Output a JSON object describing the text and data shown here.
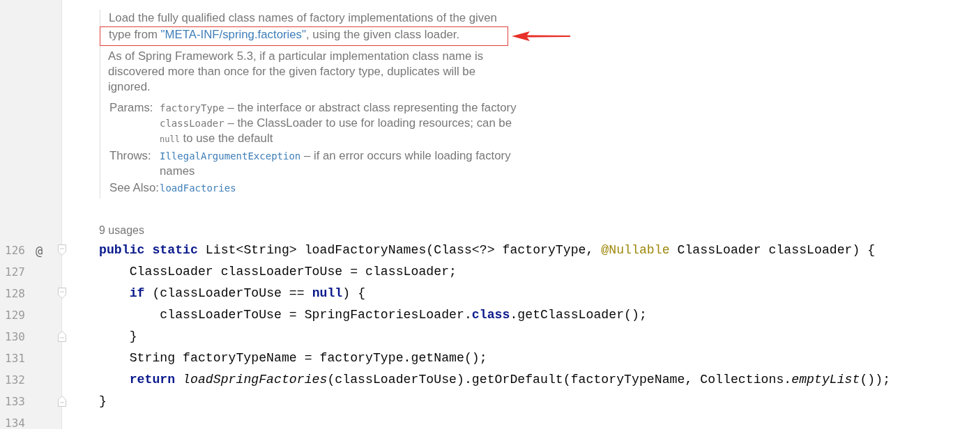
{
  "doc": {
    "summary_lines": [
      {
        "highlighted": false,
        "segments": [
          {
            "kind": "text",
            "text": "Load the fully qualified class names of factory implementations of the given"
          }
        ]
      },
      {
        "highlighted": true,
        "segments": [
          {
            "kind": "text",
            "text": "type from "
          },
          {
            "kind": "link",
            "text": "\"META-INF/spring.factories\""
          },
          {
            "kind": "text",
            "text": ", using the given class loader."
          }
        ]
      }
    ],
    "paragraph": "As of Spring Framework 5.3, if a particular implementation class name is discovered more than once for the given factory type, duplicates will be ignored.",
    "sections": [
      {
        "label": "Params:",
        "entries": [
          {
            "code": {
              "kind": "code",
              "text": "factoryType"
            },
            "text": " – the interface or abstract class representing the factory"
          },
          {
            "code": {
              "kind": "code",
              "text": "classLoader"
            },
            "text": " – the ClassLoader to use for loading resources; can be ",
            "tail_code": "null",
            "tail": " to use the default"
          }
        ]
      },
      {
        "label": "Throws:",
        "entries": [
          {
            "code": {
              "kind": "link",
              "text": "IllegalArgumentException"
            },
            "text": " – if an error occurs while loading factory names"
          }
        ]
      },
      {
        "label": "See Also:",
        "entries": [
          {
            "code": {
              "kind": "link",
              "text": "loadFactories"
            }
          }
        ]
      }
    ]
  },
  "usages": "9 usages",
  "lines": [
    {
      "number": "126",
      "gutter_mark": "@",
      "fold_marker": {
        "kind": "start"
      },
      "tokens": [
        {
          "kind": "keyword",
          "text": "public static "
        },
        {
          "kind": "plain",
          "text": "List<String> loadFactoryNames(Class<?> factoryType, "
        },
        {
          "kind": "annotation",
          "text": "@Nullable"
        },
        {
          "kind": "plain",
          "text": " ClassLoader classLoader) {"
        }
      ]
    },
    {
      "number": "127",
      "tokens": [
        {
          "kind": "plain",
          "text": "    ClassLoader classLoaderToUse = classLoader;"
        }
      ]
    },
    {
      "number": "128",
      "fold_marker": {
        "kind": "start"
      },
      "tokens": [
        {
          "kind": "keyword",
          "text": "    if"
        },
        {
          "kind": "plain",
          "text": " (classLoaderToUse == "
        },
        {
          "kind": "keyword",
          "text": "null"
        },
        {
          "kind": "plain",
          "text": ") {"
        }
      ]
    },
    {
      "number": "129",
      "tokens": [
        {
          "kind": "plain",
          "text": "        classLoaderToUse = SpringFactoriesLoader."
        },
        {
          "kind": "keyword",
          "text": "class"
        },
        {
          "kind": "plain",
          "text": ".getClassLoader();"
        }
      ]
    },
    {
      "number": "130",
      "fold_marker": {
        "kind": "end"
      },
      "tokens": [
        {
          "kind": "plain",
          "text": "    }"
        }
      ]
    },
    {
      "number": "131",
      "tokens": [
        {
          "kind": "plain",
          "text": "    String factoryTypeName = factoryType.getName();"
        }
      ]
    },
    {
      "number": "132",
      "tokens": [
        {
          "kind": "keyword",
          "text": "    return "
        },
        {
          "kind": "italic",
          "text": "loadSpringFactories"
        },
        {
          "kind": "plain",
          "text": "(classLoaderToUse).getOrDefault(factoryTypeName, Collections."
        },
        {
          "kind": "italic",
          "text": "emptyList"
        },
        {
          "kind": "plain",
          "text": "());"
        }
      ]
    },
    {
      "number": "133",
      "fold_marker": {
        "kind": "end"
      },
      "tokens": [
        {
          "kind": "plain",
          "text": "}"
        }
      ]
    },
    {
      "number": "134"
    }
  ]
}
